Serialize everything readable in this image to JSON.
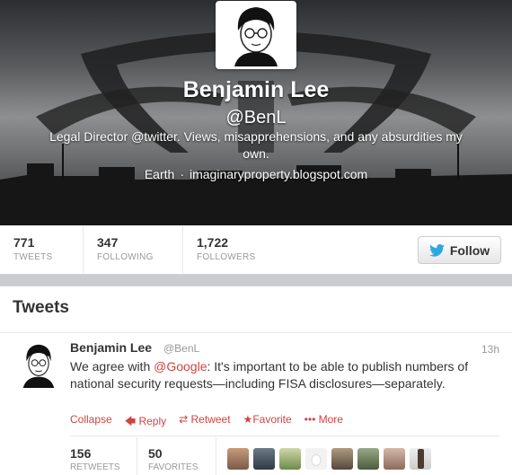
{
  "profile": {
    "name": "Benjamin Lee",
    "handle": "@BenL",
    "bio": "Legal Director @twitter. Views, misapprehensions, and any absurdities my own.",
    "location": "Earth",
    "separator": "·",
    "url": "imaginaryproperty.blogspot.com"
  },
  "stats": [
    {
      "value": "771",
      "label": "TWEETS"
    },
    {
      "value": "347",
      "label": "FOLLOWING"
    },
    {
      "value": "1,722",
      "label": "FOLLOWERS"
    }
  ],
  "follow_button": {
    "label": "Follow",
    "icon": "twitter-bird-icon"
  },
  "tweets": {
    "heading": "Tweets",
    "tweet": {
      "name": "Benjamin Lee",
      "handle": "@BenL",
      "time": "13h",
      "text_before": "We agree with ",
      "mention": "@Google",
      "text_after": ": It's important to be able to publish numbers of national security requests—including FISA disclosures—separately.",
      "actions": {
        "collapse": "Collapse",
        "reply": "Reply",
        "retweet": "Retweet",
        "favorite": "Favorite",
        "more": "More"
      },
      "retweets": {
        "value": "156",
        "label": "RETWEETS"
      },
      "favorites": {
        "value": "50",
        "label": "FAVORITES"
      }
    }
  },
  "colors": {
    "accent": "#d1433f",
    "twitter_blue": "#2aa9e0",
    "text": "#333333",
    "muted": "#999999"
  }
}
